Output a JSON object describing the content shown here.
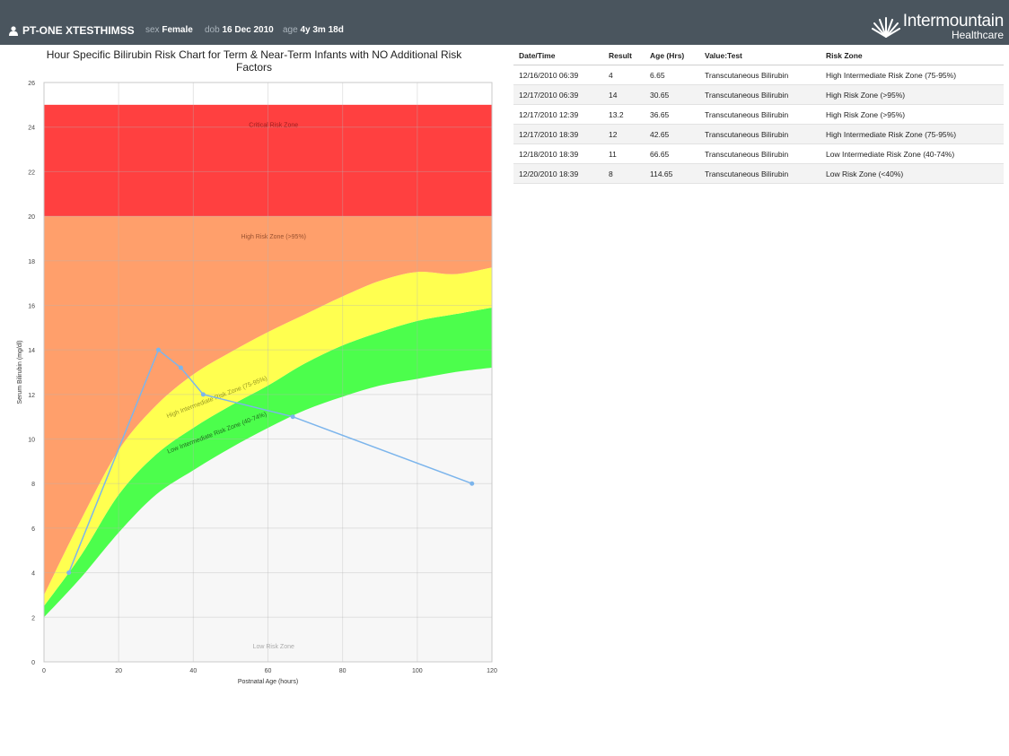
{
  "header": {
    "patient_name": "PT-ONE XTESTHIMSS",
    "sex_label": "sex",
    "sex_value": "Female",
    "dob_label": "dob",
    "dob_value": "16 Dec 2010",
    "age_label": "age",
    "age_value": "4y 3m 18d",
    "brand_main": "Intermountain",
    "brand_sub": "Healthcare"
  },
  "chart_data": {
    "type": "area",
    "title": "Hour Specific Bilirubin Risk Chart for Term & Near-Term Infants with NO Additional Risk Factors",
    "title_line1": "Hour Specific Bilirubin Risk Chart for Term & Near-Term Infants with NO Additional Risk",
    "title_line2": "Factors",
    "xlabel": "Postnatal Age (hours)",
    "ylabel": "Serum Bilirubin (mg/dl)",
    "xlim": [
      0,
      120
    ],
    "ylim": [
      0,
      26
    ],
    "x_ticks": [
      0,
      20,
      40,
      60,
      80,
      100,
      120
    ],
    "y_ticks": [
      0,
      2,
      4,
      6,
      8,
      10,
      12,
      14,
      16,
      18,
      20,
      22,
      24,
      26
    ],
    "grid": true,
    "zones": [
      {
        "name": "Critical Risk Zone",
        "color": "#ff4040",
        "lower": "flat 20",
        "upper": "flat 25"
      },
      {
        "name": "High Risk Zone (>95%)",
        "color": "#ff9f6b",
        "lower": "p95 curve",
        "upper": "flat 20"
      },
      {
        "name": "High Intermediate Risk Zone (75-95%)",
        "color": "#ffff50",
        "lower": "p75 curve",
        "upper": "p95 curve"
      },
      {
        "name": "Low Intermediate Risk Zone (40-74%)",
        "color": "#4cfe4c",
        "lower": "p40 curve",
        "upper": "p75 curve"
      },
      {
        "name": "Low Risk Zone",
        "color": "#f7f7f7",
        "lower": "flat 0",
        "upper": "p40 curve"
      }
    ],
    "curves": {
      "x": [
        0,
        10,
        20,
        30,
        40,
        50,
        60,
        70,
        80,
        90,
        100,
        110,
        120
      ],
      "p95": [
        3.0,
        6.4,
        9.5,
        11.5,
        12.9,
        13.9,
        14.8,
        15.6,
        16.4,
        17.1,
        17.5,
        17.4,
        17.7
      ],
      "p75": [
        2.5,
        4.8,
        7.5,
        9.3,
        10.5,
        11.5,
        12.4,
        13.4,
        14.2,
        14.8,
        15.3,
        15.6,
        15.9
      ],
      "p40": [
        2.0,
        3.8,
        5.8,
        7.5,
        8.6,
        9.6,
        10.5,
        11.3,
        11.9,
        12.4,
        12.7,
        13.0,
        13.2
      ]
    },
    "series": [
      {
        "x": [
          6.65,
          30.65,
          36.65,
          42.65,
          66.65,
          114.65
        ],
        "y": [
          4,
          14,
          13.2,
          12,
          11,
          8
        ],
        "color": "#7cb5ec"
      }
    ]
  },
  "results_table": {
    "headers": [
      "Date/Time",
      "Result",
      "Age (Hrs)",
      "Value:Test",
      "Risk Zone"
    ],
    "rows": [
      [
        "12/16/2010 06:39",
        "4",
        "6.65",
        "Transcutaneous Bilirubin",
        "High Intermediate Risk Zone (75-95%)"
      ],
      [
        "12/17/2010 06:39",
        "14",
        "30.65",
        "Transcutaneous Bilirubin",
        "High Risk Zone (>95%)"
      ],
      [
        "12/17/2010 12:39",
        "13.2",
        "36.65",
        "Transcutaneous Bilirubin",
        "High Risk Zone (>95%)"
      ],
      [
        "12/17/2010 18:39",
        "12",
        "42.65",
        "Transcutaneous Bilirubin",
        "High Intermediate Risk Zone (75-95%)"
      ],
      [
        "12/18/2010 18:39",
        "11",
        "66.65",
        "Transcutaneous Bilirubin",
        "Low Intermediate Risk Zone (40-74%)"
      ],
      [
        "12/20/2010 18:39",
        "8",
        "114.65",
        "Transcutaneous Bilirubin",
        "Low Risk Zone (<40%)"
      ]
    ]
  }
}
